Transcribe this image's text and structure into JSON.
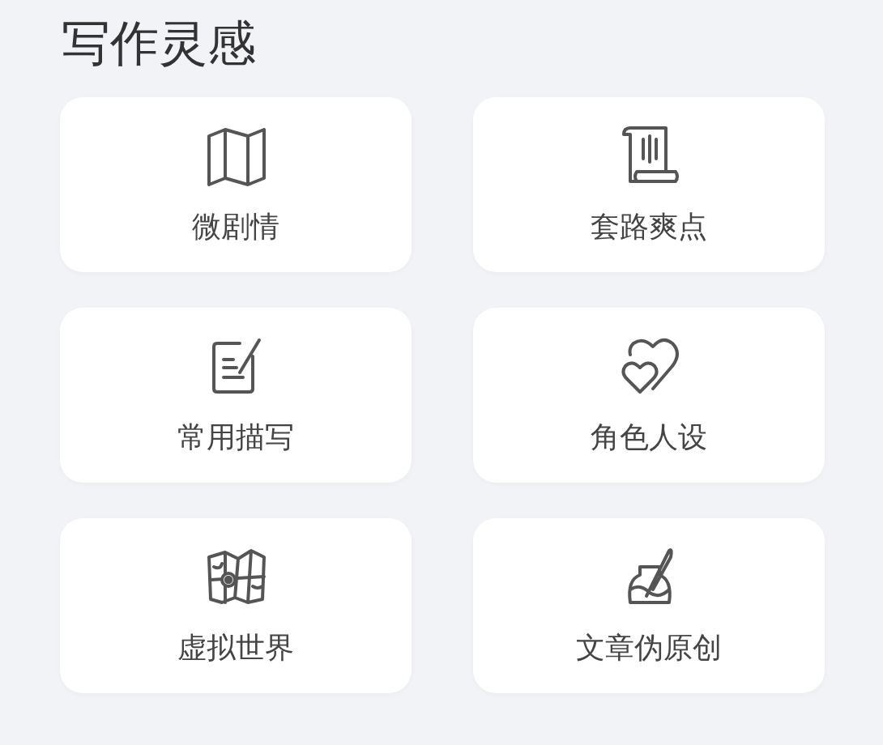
{
  "title": "写作灵感",
  "cards": [
    {
      "label": "微剧情",
      "kind": "map"
    },
    {
      "label": "套路爽点",
      "kind": "scroll"
    },
    {
      "label": "常用描写",
      "kind": "note"
    },
    {
      "label": "角色人设",
      "kind": "hearts"
    },
    {
      "label": "虚拟世界",
      "kind": "world"
    },
    {
      "label": "文章伪原创",
      "kind": "ink"
    }
  ]
}
